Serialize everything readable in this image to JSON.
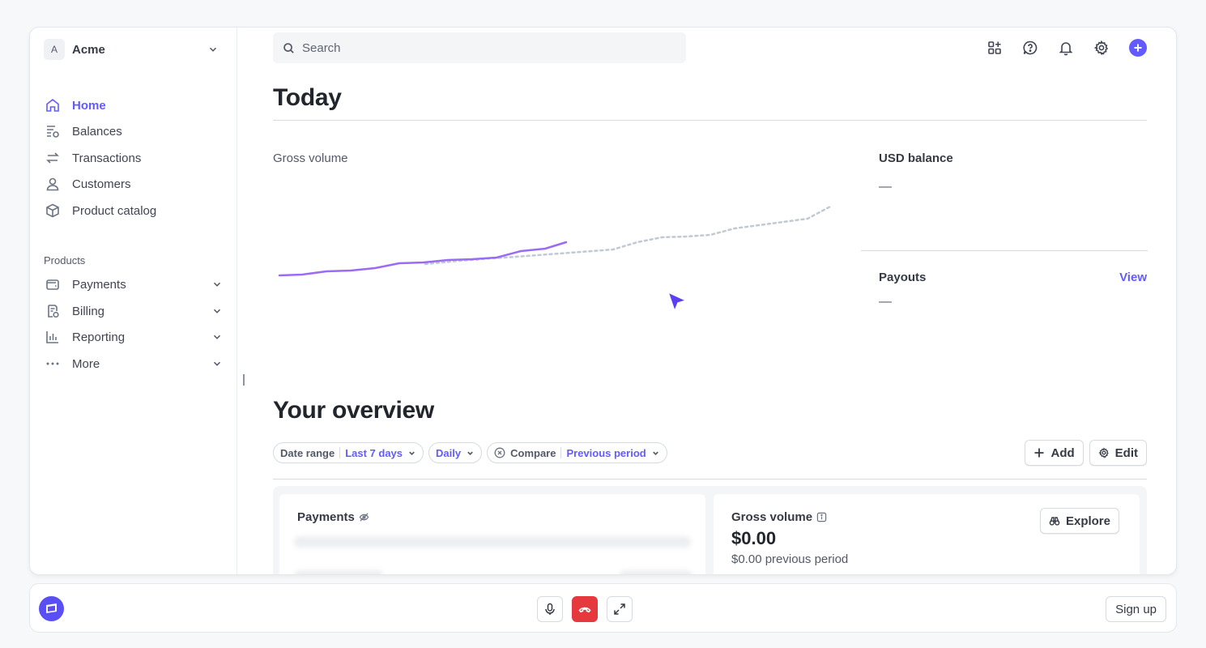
{
  "sidebar": {
    "account": {
      "initial": "A",
      "name": "Acme"
    },
    "items": [
      {
        "label": "Home",
        "icon": "home-icon",
        "active": true
      },
      {
        "label": "Balances",
        "icon": "balances-icon"
      },
      {
        "label": "Transactions",
        "icon": "transactions-icon"
      },
      {
        "label": "Customers",
        "icon": "customers-icon"
      },
      {
        "label": "Product catalog",
        "icon": "product-catalog-icon"
      }
    ],
    "section_label": "Products",
    "product_items": [
      {
        "label": "Payments",
        "icon": "wallet-icon"
      },
      {
        "label": "Billing",
        "icon": "billing-icon"
      },
      {
        "label": "Reporting",
        "icon": "reporting-icon"
      },
      {
        "label": "More",
        "icon": "more-icon"
      }
    ]
  },
  "header": {
    "search_placeholder": "Search",
    "icons": [
      "apps-add-icon",
      "help-icon",
      "bell-icon",
      "gear-icon",
      "plus-circle-icon"
    ]
  },
  "today": {
    "title": "Today",
    "gross_volume_label": "Gross volume",
    "usd_balance_label": "USD balance",
    "usd_balance_value": "—",
    "payouts_label": "Payouts",
    "payouts_value": "—",
    "payouts_link": "View"
  },
  "overview": {
    "title": "Your overview",
    "filters": {
      "date_range_label": "Date range",
      "date_range_value": "Last 7 days",
      "interval_value": "Daily",
      "compare_label": "Compare",
      "compare_value": "Previous period"
    },
    "add_label": "Add",
    "edit_label": "Edit",
    "cards": {
      "payments_title": "Payments",
      "gross_title": "Gross volume",
      "gross_amount": "$0.00",
      "gross_previous": "$0.00 previous period",
      "explore_label": "Explore"
    }
  },
  "bottom_bar": {
    "sign_up_label": "Sign up"
  },
  "colors": {
    "accent": "#635bff",
    "today_line": "#9c6bf5",
    "comparison_line": "#c1c9d2",
    "end_call": "#e5393e"
  }
}
